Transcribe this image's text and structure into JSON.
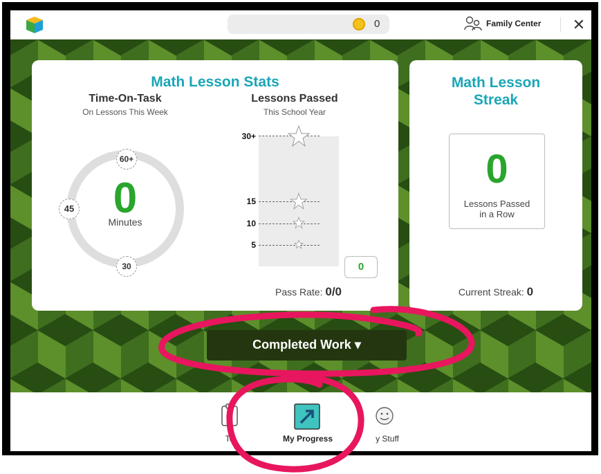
{
  "topbar": {
    "coin_count": "0",
    "family_center_label": "Family Center",
    "close_label": "✕"
  },
  "stats_card": {
    "title": "Math Lesson Stats",
    "time_on_task": {
      "title": "Time-On-Task",
      "subtitle": "On Lessons This Week",
      "value": "0",
      "unit": "Minutes",
      "ring_labels": [
        "60+",
        "45",
        "30"
      ]
    },
    "lessons_passed": {
      "title": "Lessons Passed",
      "subtitle": "This School Year",
      "tick_labels": [
        "30+",
        "15",
        "10",
        "5"
      ],
      "current_value": "0",
      "pass_rate_label": "Pass Rate:",
      "pass_rate_value": "0/0"
    }
  },
  "streak_card": {
    "title_line1": "Math Lesson",
    "title_line2": "Streak",
    "value": "0",
    "value_label_line1": "Lessons Passed",
    "value_label_line2": "in a Row",
    "current_streak_label": "Current Streak:",
    "current_streak_value": "0"
  },
  "completed_work_button": {
    "label": "Completed Work ▾"
  },
  "bottom_nav": {
    "items": [
      {
        "label": "To",
        "icon": "clipboard-icon"
      },
      {
        "label": "My Progress",
        "icon": "arrow-up-right-icon"
      },
      {
        "label": "y Stuff",
        "icon": "smiley-icon"
      }
    ]
  },
  "colors": {
    "teal": "#1aa6b7",
    "green_value": "#2aa52d",
    "annotation": "#e8165e",
    "button_dark": "#24360f"
  }
}
